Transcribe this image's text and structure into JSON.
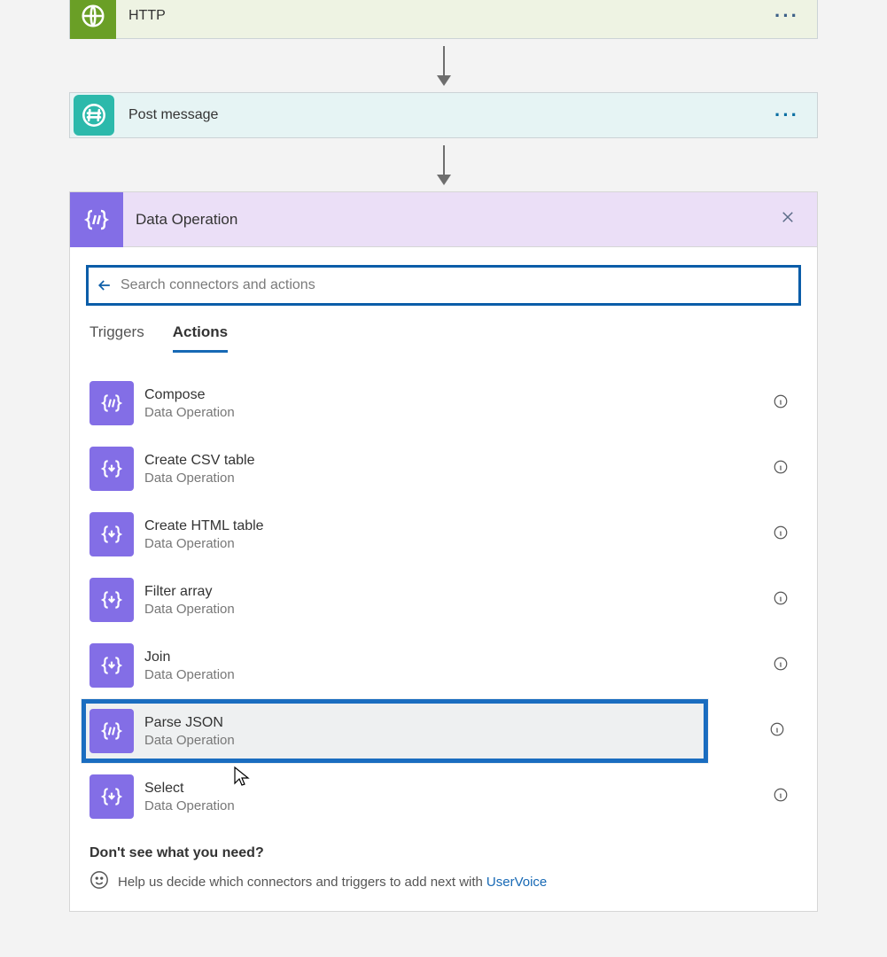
{
  "steps": {
    "http": "HTTP",
    "slack": "Post message"
  },
  "panel": {
    "title": "Data Operation",
    "search_placeholder": "Search connectors and actions",
    "tabs": {
      "triggers": "Triggers",
      "actions": "Actions"
    },
    "actions": [
      {
        "name": "Compose",
        "sub": "Data Operation"
      },
      {
        "name": "Create CSV table",
        "sub": "Data Operation"
      },
      {
        "name": "Create HTML table",
        "sub": "Data Operation"
      },
      {
        "name": "Filter array",
        "sub": "Data Operation"
      },
      {
        "name": "Join",
        "sub": "Data Operation"
      },
      {
        "name": "Parse JSON",
        "sub": "Data Operation"
      },
      {
        "name": "Select",
        "sub": "Data Operation"
      }
    ],
    "footer": {
      "title": "Don't see what you need?",
      "text": "Help us decide which connectors and triggers to add next with",
      "link": "UserVoice"
    }
  }
}
